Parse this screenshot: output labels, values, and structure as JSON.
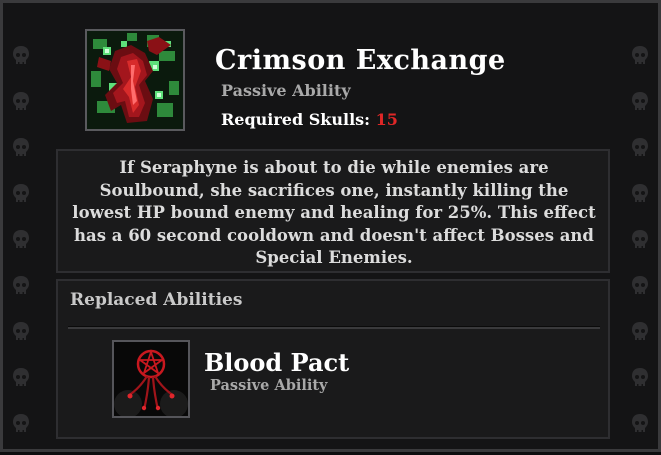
{
  "ability": {
    "name": "Crimson Exchange",
    "type": "Passive Ability",
    "required_label": "Required Skulls: ",
    "required_value": "15",
    "description": "If Seraphyne is about to die while enemies are Soulbound, she sacrifices one, instantly killing the lowest HP bound enemy and healing for 25%. This effect has a 60 second cooldown and doesn't affect Bosses and Special Enemies."
  },
  "replaced": {
    "heading": "Replaced Abilities",
    "items": [
      {
        "name": "Blood Pact",
        "type": "Passive Ability",
        "icon": "pentagram-chain-icon"
      }
    ]
  },
  "icons": {
    "main": "crimson-exchange-icon",
    "border": "skull-icon"
  },
  "colors": {
    "accent_red": "#e02727",
    "title": "#ffffff",
    "subtitle": "#a9a9a9",
    "panel": "#1a1a1b"
  }
}
